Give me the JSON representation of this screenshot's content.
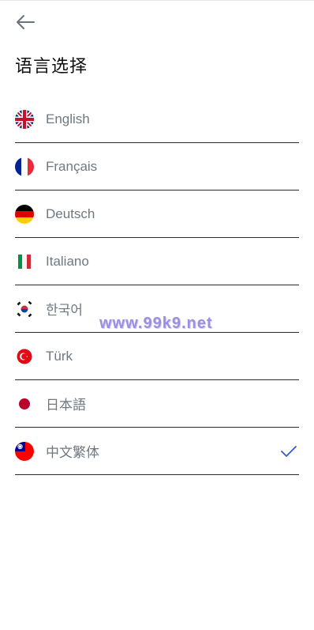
{
  "header": {
    "title": "语言选择"
  },
  "icons": {
    "back": "arrow-left-icon",
    "check": "check-icon"
  },
  "colors": {
    "accent": "#2f5bd3",
    "label": "#6f7880",
    "divider": "#2b2b2b"
  },
  "languages": [
    {
      "label": "English",
      "flag": "uk-flag-icon",
      "selected": false
    },
    {
      "label": "Français",
      "flag": "france-flag-icon",
      "selected": false
    },
    {
      "label": "Deutsch",
      "flag": "germany-flag-icon",
      "selected": false
    },
    {
      "label": "Italiano",
      "flag": "italy-flag-icon",
      "selected": false
    },
    {
      "label": "한국어",
      "flag": "korea-flag-icon",
      "selected": false
    },
    {
      "label": "Türk",
      "flag": "turkey-flag-icon",
      "selected": false
    },
    {
      "label": "日本語",
      "flag": "japan-flag-icon",
      "selected": false
    },
    {
      "label": "中文繁体",
      "flag": "taiwan-flag-icon",
      "selected": true
    }
  ],
  "watermark": {
    "text": "www.99k9.net"
  }
}
